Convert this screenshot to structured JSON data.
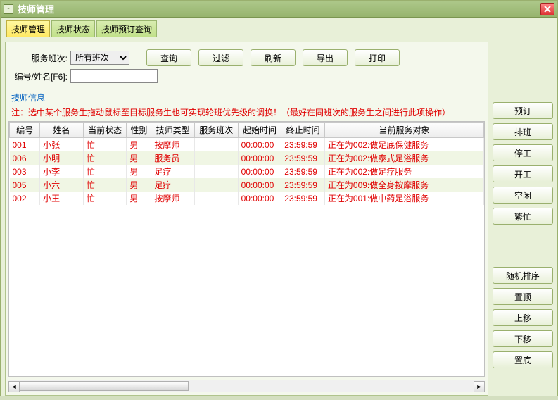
{
  "window": {
    "title": "技师管理"
  },
  "tabs": [
    {
      "label": "技师管理",
      "active": true
    },
    {
      "label": "技师状态",
      "active": false
    },
    {
      "label": "技师预订查询",
      "active": false
    }
  ],
  "filters": {
    "shift_label": "服务班次:",
    "shift_value": "所有班次",
    "id_name_label": "编号/姓名[F6]:",
    "id_name_value": ""
  },
  "toolbar": {
    "query": "查询",
    "filter": "过滤",
    "refresh": "刷新",
    "export": "导出",
    "print": "打印"
  },
  "fieldset_label": "技师信息",
  "note": "注：选中某个服务生拖动鼠标至目标服务生也可实现轮班优先级的调换！（最好在同班次的服务生之间进行此项操作）",
  "table": {
    "headers": [
      "编号",
      "姓名",
      "当前状态",
      "性别",
      "技师类型",
      "服务班次",
      "起始时间",
      "终止时间",
      "当前服务对象"
    ],
    "widths": [
      42,
      60,
      60,
      34,
      60,
      60,
      60,
      60,
      220
    ],
    "rows": [
      [
        "001",
        "小张",
        "忙",
        "男",
        "按摩师",
        "",
        "00:00:00",
        "23:59:59",
        "正在为002:做足底保健服务"
      ],
      [
        "006",
        "小明",
        "忙",
        "男",
        "服务员",
        "",
        "00:00:00",
        "23:59:59",
        "正在为002:做泰式足浴服务"
      ],
      [
        "003",
        "小李",
        "忙",
        "男",
        "足疗",
        "",
        "00:00:00",
        "23:59:59",
        "正在为002:做足疗服务"
      ],
      [
        "005",
        "小六",
        "忙",
        "男",
        "足疗",
        "",
        "00:00:00",
        "23:59:59",
        "正在为009:做全身按摩服务"
      ],
      [
        "002",
        "小王",
        "忙",
        "男",
        "按摩师",
        "",
        "00:00:00",
        "23:59:59",
        "正在为001:做中药足浴服务"
      ]
    ]
  },
  "side_buttons_top": [
    "预订",
    "排班",
    "停工",
    "开工",
    "空闲",
    "繁忙"
  ],
  "side_buttons_bottom": [
    "随机排序",
    "置顶",
    "上移",
    "下移",
    "置底"
  ]
}
